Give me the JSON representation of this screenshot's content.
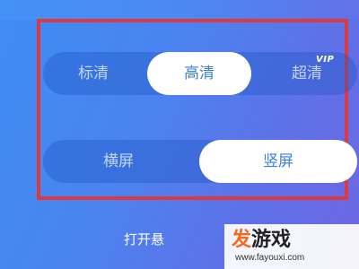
{
  "quality": {
    "options": [
      "标清",
      "高清",
      "超清"
    ],
    "selected_index": 1,
    "vip_badge": "VIP"
  },
  "orientation": {
    "options": [
      "横屏",
      "竖屏"
    ],
    "selected_index": 1
  },
  "bottom_text": "打开悬",
  "watermark": {
    "logo_accent": "发",
    "logo_rest": "游戏",
    "url": "www.fayouxi.com"
  },
  "colors": {
    "highlight_border": "#dd3a3f",
    "selected_text": "#3a7fd8",
    "watermark_accent": "#f26a1b"
  }
}
